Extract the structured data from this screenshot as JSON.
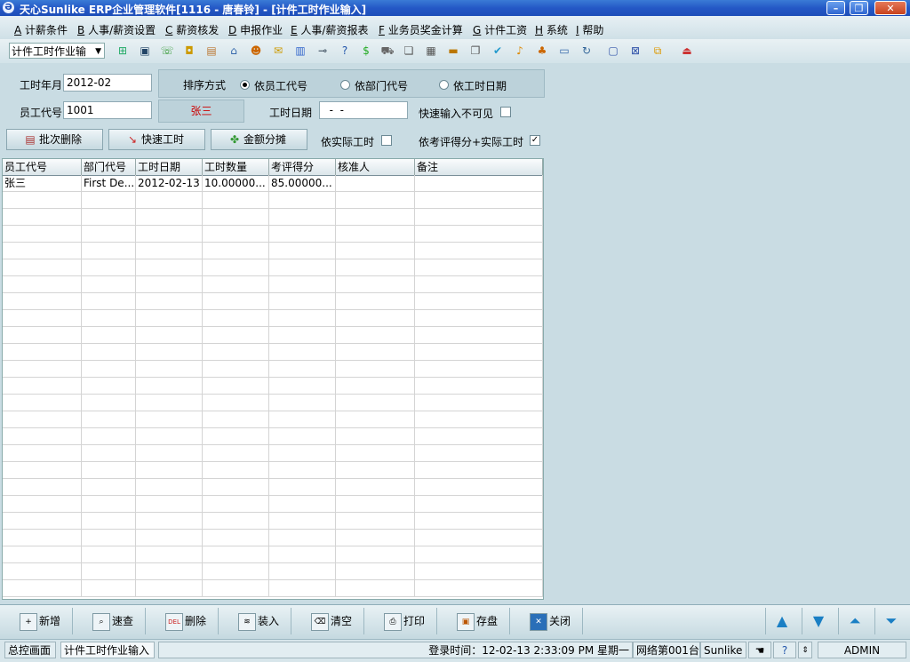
{
  "window": {
    "title": "天心Sunlike ERP企业管理软件[1116 - 唐春铃] - [计件工时作业输入]",
    "minimize_glyph": "–",
    "restore_glyph": "❐",
    "close_glyph": "✕"
  },
  "menu": [
    {
      "key": "A",
      "label": "计薪条件"
    },
    {
      "key": "B",
      "label": "人事/薪资设置"
    },
    {
      "key": "C",
      "label": "薪资核发"
    },
    {
      "key": "D",
      "label": "申报作业"
    },
    {
      "key": "E",
      "label": "人事/薪资报表"
    },
    {
      "key": "F",
      "label": "业务员奖金计算"
    },
    {
      "key": "G",
      "label": "计件工资"
    },
    {
      "key": "H",
      "label": "系统"
    },
    {
      "key": "I",
      "label": "帮助"
    }
  ],
  "toolbar": {
    "mode_select": "计件工时作业输",
    "icons": [
      "tree-icon",
      "monitor-icon",
      "phone-icon",
      "lock-icon",
      "briefcase-icon",
      "home-icon",
      "people-icon",
      "mail-icon",
      "book-icon",
      "key-icon",
      "help-icon",
      "dollar-icon",
      "cart-icon",
      "document-icon",
      "calculator-icon",
      "card-icon",
      "copy-icon",
      "check-icon",
      "bell-icon",
      "org-icon",
      "display-icon",
      "refresh-icon",
      "window-icon",
      "close-window-icon",
      "cascade-icon",
      "exit-icon"
    ]
  },
  "form": {
    "work_month_label": "工时年月",
    "work_month_value": "2012-02",
    "sort_label": "排序方式",
    "sort_options": [
      "依员工代号",
      "依部门代号",
      "依工时日期"
    ],
    "sort_selected": 0,
    "employee_code_label": "员工代号",
    "employee_code_value": "1001",
    "employee_name": "张三",
    "work_date_label": "工时日期",
    "work_date_value": "  -  -",
    "quick_input_label": "快速输入不可见",
    "quick_input_checked": false,
    "batch_delete_label": "批次删除",
    "quick_hours_label": "快速工时",
    "amount_split_label": "金额分摊",
    "by_actual_hours_label": "依实际工时",
    "by_actual_hours_checked": false,
    "by_score_hours_label": "依考评得分+实际工时",
    "by_score_hours_checked": true
  },
  "grid": {
    "columns": [
      "员工代号",
      "部门代号",
      "工时日期",
      "工时数量",
      "考评得分",
      "核准人",
      "备注"
    ],
    "rows": [
      [
        "张三",
        "First De...",
        "2012-02-13",
        "10.00000...",
        "85.00000...",
        "",
        ""
      ]
    ]
  },
  "bottom_toolbar": {
    "new": "新增",
    "search": "速查",
    "delete": "删除",
    "import": "装入",
    "clear": "清空",
    "print": "打印",
    "save": "存盘",
    "close": "关闭"
  },
  "status": {
    "tab_main": "总控画面",
    "tab_current": "计件工时作业输入",
    "login_time": "登录时间：12-02-13 2:33:09 PM  星期一",
    "network": "网络第001台",
    "product": "Sunlike E",
    "user": "ADMIN"
  },
  "colors": {
    "title_bar": "#2458c6",
    "background": "#c9dce3",
    "employee_name_text": "#cc0000",
    "nav_arrows": "#1a7fc4"
  }
}
